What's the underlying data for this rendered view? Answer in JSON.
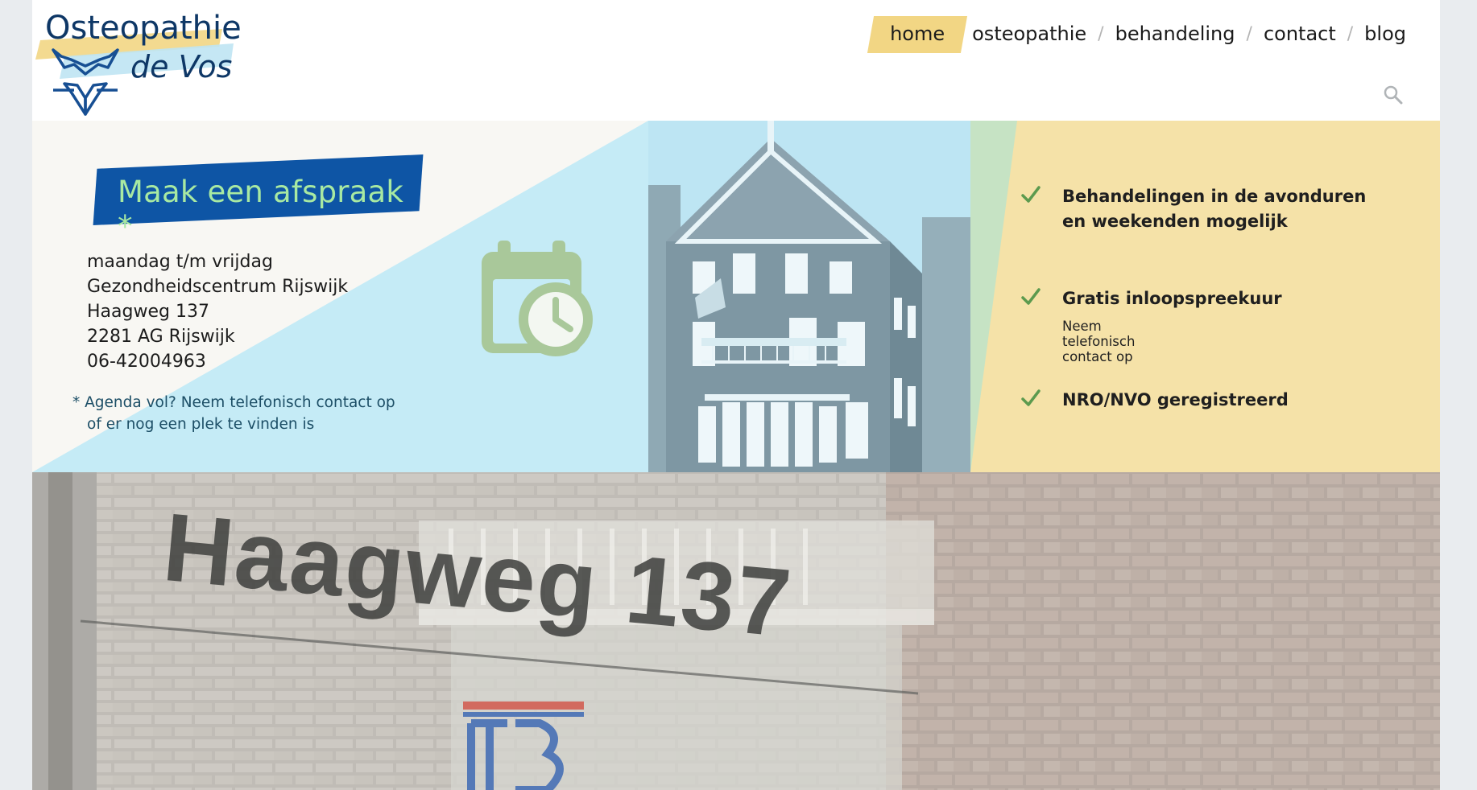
{
  "header": {
    "logo": {
      "line1": "Osteopathie",
      "line2": "de Vos",
      "icon": "fox-icon"
    },
    "nav": [
      {
        "label": "home",
        "active": true
      },
      {
        "label": "osteopathie",
        "active": false
      },
      {
        "label": "behandeling",
        "active": false
      },
      {
        "label": "contact",
        "active": false
      },
      {
        "label": "blog",
        "active": false
      }
    ],
    "separator": "/",
    "search_icon": "search-icon"
  },
  "appointment": {
    "cta_label": "Maak een afspraak *",
    "address_lines": [
      "maandag t/m vrijdag",
      "Gezondheidscentrum Rijswijk",
      "Haagweg 137",
      "2281 AG Rijswijk",
      "06-42004963"
    ],
    "note_line1": "* Agenda vol? Neem telefonisch contact op",
    "note_line2": "of er nog een plek te vinden is",
    "icon": "calendar-clock-icon"
  },
  "features": [
    {
      "title": "Behandelingen in de avonduren en weekenden mogelijk",
      "subtitle": ""
    },
    {
      "title": "Gratis inloopspreekuur",
      "subtitle": "Neem telefonisch contact op"
    },
    {
      "title": "NRO/NVO geregistreerd",
      "subtitle": ""
    }
  ],
  "photo": {
    "sign_text": "Haagweg 137"
  },
  "colors": {
    "accent_yellow": "#f2d684",
    "brand_blue": "#0e55a5",
    "cta_text": "#a8e9a2",
    "light_blue": "#c5ebf6",
    "check_green": "#5c9a4e",
    "icon_green": "#a9c89a"
  }
}
